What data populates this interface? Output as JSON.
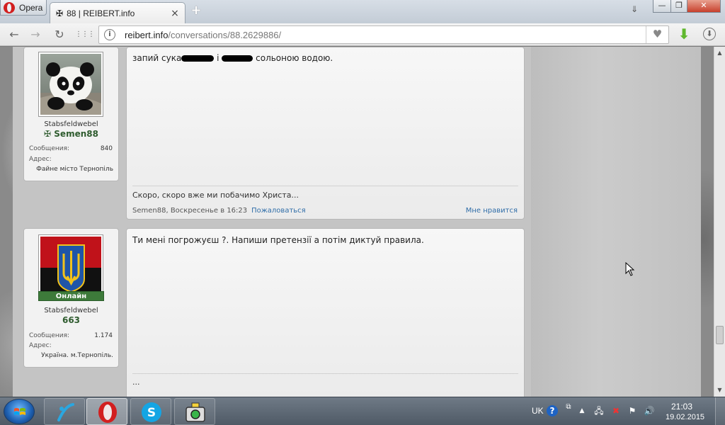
{
  "browser": {
    "menu_label": "Opera",
    "tab_title": "88 | REIBERT.info",
    "tab_favicon": "✠",
    "tab_close": "×",
    "new_tab": "+",
    "tab_menu": "⇓",
    "window": {
      "minimize": "—",
      "restore": "❐",
      "close": "✕"
    },
    "nav": {
      "back": "←",
      "forward": "→",
      "reload": "↻",
      "speed_dial": "⋮⋮⋮"
    },
    "url": {
      "host": "reibert.info",
      "path": "/conversations/88.2629886/",
      "info_icon": "i"
    },
    "bookmark_heart": "♥",
    "download_icon": "⬇",
    "downloads_circle": "⬇"
  },
  "posts": [
    {
      "user": {
        "rank": "Stabsfeldwebel",
        "name_prefix": "✠",
        "name": "Semen88",
        "messages_label": "Сообщения:",
        "messages_value": "840",
        "address_label": "Адрес:",
        "address_value": "Файне місто Тернопіль",
        "avatar": "panda-avatar"
      },
      "text_before": "запий сука",
      "text_mid": "і",
      "text_after": "сольоною водою.",
      "signature": "Скоро, скоро вже ми побачимо Христа...",
      "meta": "Semen88, Воскресенье в 16:23",
      "report": "Пожаловаться",
      "like": "Мне нравится"
    },
    {
      "user": {
        "online": "Онлайн",
        "rank": "Stabsfeldwebel",
        "name": "663",
        "messages_label": "Сообщения:",
        "messages_value": "1.174",
        "address_label": "Адрес:",
        "address_value": "Україна. м.Тернопіль.",
        "avatar": "trident-flag-avatar"
      },
      "text": "Ти мені погрожуєш ?. Напиши претензії а потім диктуй правила.",
      "signature": "..."
    }
  ],
  "taskbar": {
    "lang": "UK",
    "time": "21:03",
    "date": "19.02.2015"
  },
  "colors": {
    "username_green": "#2e5b2e",
    "link_blue": "#2f6da8",
    "online_green": "#3d7a3a",
    "flag_red": "#c0121a",
    "flag_black": "#111111",
    "trident_gold": "#f2c21a",
    "trident_blue": "#1f55a8"
  }
}
